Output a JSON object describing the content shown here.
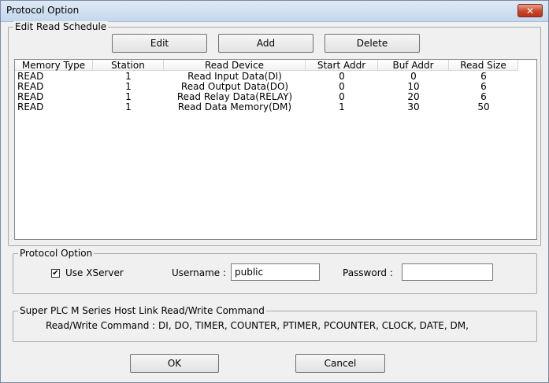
{
  "window": {
    "title": "Protocol Option",
    "close_glyph": "✕",
    "close_icon": "close-icon"
  },
  "schedule": {
    "title": "Edit Read Schedule",
    "buttons": {
      "edit": "Edit",
      "add": "Add",
      "delete": "Delete"
    },
    "columns": [
      "Memory Type",
      "Station",
      "Read Device",
      "Start Addr",
      "Buf Addr",
      "Read Size"
    ],
    "rows": [
      [
        "READ",
        "1",
        "Read Input Data(DI)",
        "0",
        "0",
        "6"
      ],
      [
        "READ",
        "1",
        "Read Output Data(DO)",
        "0",
        "10",
        "6"
      ],
      [
        "READ",
        "1",
        "Read Relay Data(RELAY)",
        "0",
        "20",
        "6"
      ],
      [
        "READ",
        "1",
        "Read Data Memory(DM)",
        "1",
        "30",
        "50"
      ]
    ]
  },
  "protocol": {
    "title": "Protocol Option",
    "use_xserver_label": "Use XServer",
    "use_xserver_checked": true,
    "check_glyph": "✔",
    "username_label": "Username :",
    "username_value": "public",
    "password_label": "Password :",
    "password_value": ""
  },
  "info": {
    "title": "Super PLC M Series Host Link Read/Write Command",
    "text": "Read/Write Command : DI, DO, TIMER, COUNTER, PTIMER, PCOUNTER, CLOCK, DATE, DM,"
  },
  "footer": {
    "ok": "OK",
    "cancel": "Cancel"
  }
}
